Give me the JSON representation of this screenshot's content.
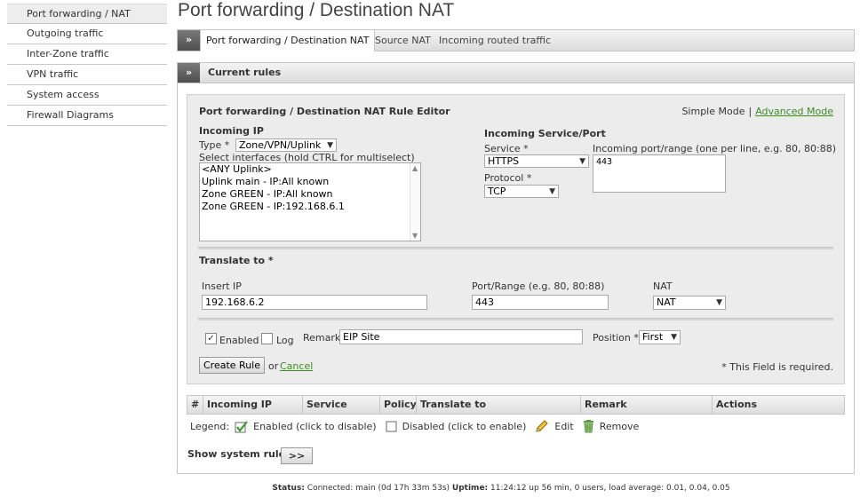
{
  "sidebar": {
    "items": [
      {
        "label": "Port forwarding / NAT",
        "active": true
      },
      {
        "label": "Outgoing traffic"
      },
      {
        "label": "Inter-Zone traffic"
      },
      {
        "label": "VPN traffic"
      },
      {
        "label": "System access"
      },
      {
        "label": "Firewall Diagrams"
      }
    ]
  },
  "page": {
    "title": "Port forwarding / Destination NAT"
  },
  "tabs": {
    "chevron": "»",
    "items": [
      {
        "label": "Port forwarding / Destination NAT",
        "active": true
      },
      {
        "label": "Source NAT"
      },
      {
        "label": "Incoming routed traffic"
      }
    ]
  },
  "panel": {
    "chevron": "»",
    "title": "Current rules"
  },
  "editor": {
    "title": "Port forwarding / Destination NAT Rule Editor",
    "mode": {
      "simple": "Simple Mode",
      "separator": "|",
      "advanced": "Advanced Mode"
    },
    "incoming_ip": {
      "heading": "Incoming IP",
      "type_label": "Type *",
      "type_value": "Zone/VPN/Uplink",
      "interfaces_label": "Select interfaces (hold CTRL for multiselect)",
      "interfaces": [
        "<ANY Uplink>",
        "Uplink main - IP:All known",
        "Zone GREEN - IP:All known",
        "Zone GREEN - IP:192.168.6.1"
      ]
    },
    "incoming_service": {
      "heading": "Incoming Service/Port",
      "service_label": "Service *",
      "service_value": "HTTPS",
      "port_label": "Incoming port/range (one per line, e.g. 80, 80:88)",
      "port_value": "443",
      "protocol_label": "Protocol *",
      "protocol_value": "TCP"
    },
    "translate": {
      "heading": "Translate to *",
      "insert_ip_label": "Insert IP",
      "insert_ip_value": "192.168.6.2",
      "port_label": "Port/Range (e.g. 80, 80:88)",
      "port_value": "443",
      "nat_label": "NAT",
      "nat_value": "NAT"
    },
    "options": {
      "enabled_label": "Enabled",
      "enabled_checked": "✓",
      "log_label": "Log",
      "remark_label": "Remark",
      "remark_value": "EIP Site",
      "position_label": "Position *",
      "position_value": "First"
    },
    "actions": {
      "create_label": "Create Rule",
      "or_text": "or",
      "cancel_label": "Cancel",
      "required_note": "* This Field is required."
    }
  },
  "table": {
    "columns": [
      "#",
      "Incoming IP",
      "Service",
      "Policy",
      "Translate to",
      "Remark",
      "Actions"
    ]
  },
  "legend": {
    "label": "Legend:",
    "enabled": "Enabled (click to disable)",
    "disabled": "Disabled (click to enable)",
    "edit": "Edit",
    "remove": "Remove"
  },
  "system_rules": {
    "label": "Show system rules",
    "button": ">>"
  },
  "status": {
    "status_label": "Status:",
    "status_value": "Connected: main (0d 17h 33m 53s)",
    "uptime_label": "Uptime:",
    "uptime_value": "11:24:12 up 56 min, 0 users, load average: 0.01, 0.04, 0.05"
  },
  "colors": {
    "link": "#3a8d1f",
    "header_dark": "#5a5a5a",
    "editor_bg": "#ececec"
  },
  "icons": {
    "enabled": "check-icon",
    "disabled": "checkbox-empty-icon",
    "edit": "pencil-icon",
    "remove": "trash-icon"
  }
}
